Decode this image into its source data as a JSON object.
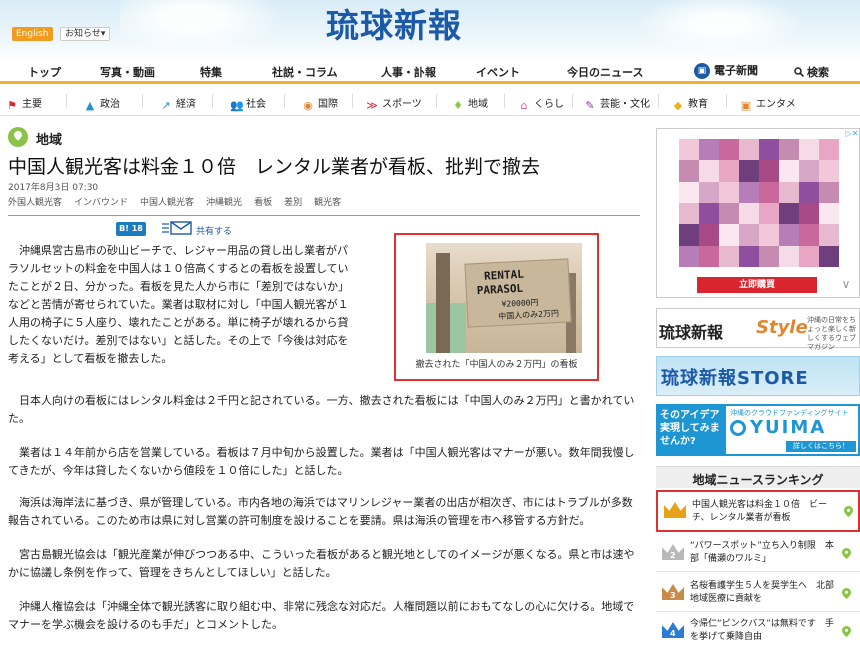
{
  "header": {
    "lang_label": "English",
    "notice_label": "お知らせ▾",
    "logo_text": "琉球新報"
  },
  "main_nav": [
    {
      "label": "トップ"
    },
    {
      "label": "写真・動画"
    },
    {
      "label": "特集"
    },
    {
      "label": "社説・コラム"
    },
    {
      "label": "人事・訃報"
    },
    {
      "label": "イベント"
    },
    {
      "label": "今日のニュース"
    },
    {
      "label": "電子新聞"
    },
    {
      "label": "検索"
    }
  ],
  "categories": [
    {
      "label": "主要",
      "icon": "flag-icon",
      "color": "#d9262e"
    },
    {
      "label": "政治",
      "icon": "building-icon",
      "color": "#1f96d4"
    },
    {
      "label": "経済",
      "icon": "chart-icon",
      "color": "#1f96d4"
    },
    {
      "label": "社会",
      "icon": "people-icon",
      "color": "#1c5aa8"
    },
    {
      "label": "国際",
      "icon": "globe-icon",
      "color": "#e3862b"
    },
    {
      "label": "スポーツ",
      "icon": "sports-icon",
      "color": "#d9262e"
    },
    {
      "label": "地域",
      "icon": "pin-icon",
      "color": "#8bc34a"
    },
    {
      "label": "くらし",
      "icon": "house-icon",
      "color": "#e85a8a"
    },
    {
      "label": "芸能・文化",
      "icon": "brush-icon",
      "color": "#8a3aa8"
    },
    {
      "label": "教育",
      "icon": "cap-icon",
      "color": "#e8b21a"
    },
    {
      "label": "エンタメ",
      "icon": "tv-icon",
      "color": "#e3862b"
    }
  ],
  "article": {
    "section": "地域",
    "title": "中国人観光客は料金１０倍　レンタル業者が看板、批判で撤去",
    "date": "2017年8月3日 07:30",
    "tags": [
      "外国人観光客",
      "インバウンド",
      "中国人観光客",
      "沖縄観光",
      "看板",
      "差別",
      "観光客"
    ],
    "bi_badge": "B! 18",
    "share_label": "共有する",
    "paragraphs": [
      "沖縄県宮古島市の砂山ビーチで、レジャー用品の貸し出し業者がパラソルセットの料金を中国人は１０倍高くするとの看板を設置していたことが２日、分かった。看板を見た人から市に「差別ではないか」などと苦情が寄せられていた。業者は取材に対し「中国人観光客が１人用の椅子に５人座り、壊れたことがある。単に椅子が壊れるから貸したくないだけ。差別ではない」と話した。その上で「今後は対応を考える」として看板を撤去した。",
      "日本人向けの看板にはレンタル料金は２千円と記されている。一方、撤去された看板には「中国人のみ２万円」と書かれていた。",
      "業者は１４年前から店を営業している。看板は７月中旬から設置した。業者は「中国人観光客はマナーが悪い。数年間我慢してきたが、今年は貸したくないから値段を１０倍にした」と話した。",
      "海浜は海岸法に基づき、県が管理している。市内各地の海浜ではマリンレジャー業者の出店が相次ぎ、市にはトラブルが多数報告されている。このため市は県に対し営業の許可制度を設けることを要請。県は海浜の管理を市へ移管する方針だ。",
      "宮古島観光協会は「観光産業が伸びつつある中、こういった看板があると観光地としてのイメージが悪くなる。県と市は速やかに協議し条例を作って、管理をきちんとしてほしい」と話した。",
      "沖縄人権協会は「沖縄全体で観光誘客に取り組む中、非常に残念な対応だ。人権問題以前におもてなしの心に欠ける。地域でマナーを学ぶ機会を設けるのも手だ」とコメントした。"
    ],
    "photo": {
      "sign_lines": [
        "RENTAL",
        "PARASOL",
        "¥20000円",
        "中国人のみ2万円"
      ],
      "caption": "撤去された「中国人のみ２万円」の看板"
    }
  },
  "sidebar": {
    "ad_button": "立即購買",
    "ad_chevron": "∨",
    "ad_close": "▷✕",
    "banner_style": {
      "name": "琉球新報",
      "brand": "Style",
      "tagline": "沖縄の日常をちょっと楽しく新しくするウェブマガジン"
    },
    "banner_store": "琉球新報STORE",
    "banner_yuima": {
      "left": "そのアイデア実現してみませんか?",
      "top": "沖縄のクラウドファンディングサイト",
      "brand": "YUIMA",
      "button": "詳しくはこちら！"
    },
    "ranking_title": "地域ニュースランキング",
    "ranking": [
      {
        "rank": "1",
        "text": "中国人観光客は料金１０倍　ビーチ、レンタル業者が看板"
      },
      {
        "rank": "2",
        "text": "“パワースポット”立ち入り制限　本部「備瀬のワルミ」"
      },
      {
        "rank": "3",
        "text": "名桜看護学生５人を奨学生へ　北部地域医療に貢献を"
      },
      {
        "rank": "4",
        "text": "今帰仁“ピンクバス”は無料です　手を挙げて乗降自由"
      }
    ]
  }
}
